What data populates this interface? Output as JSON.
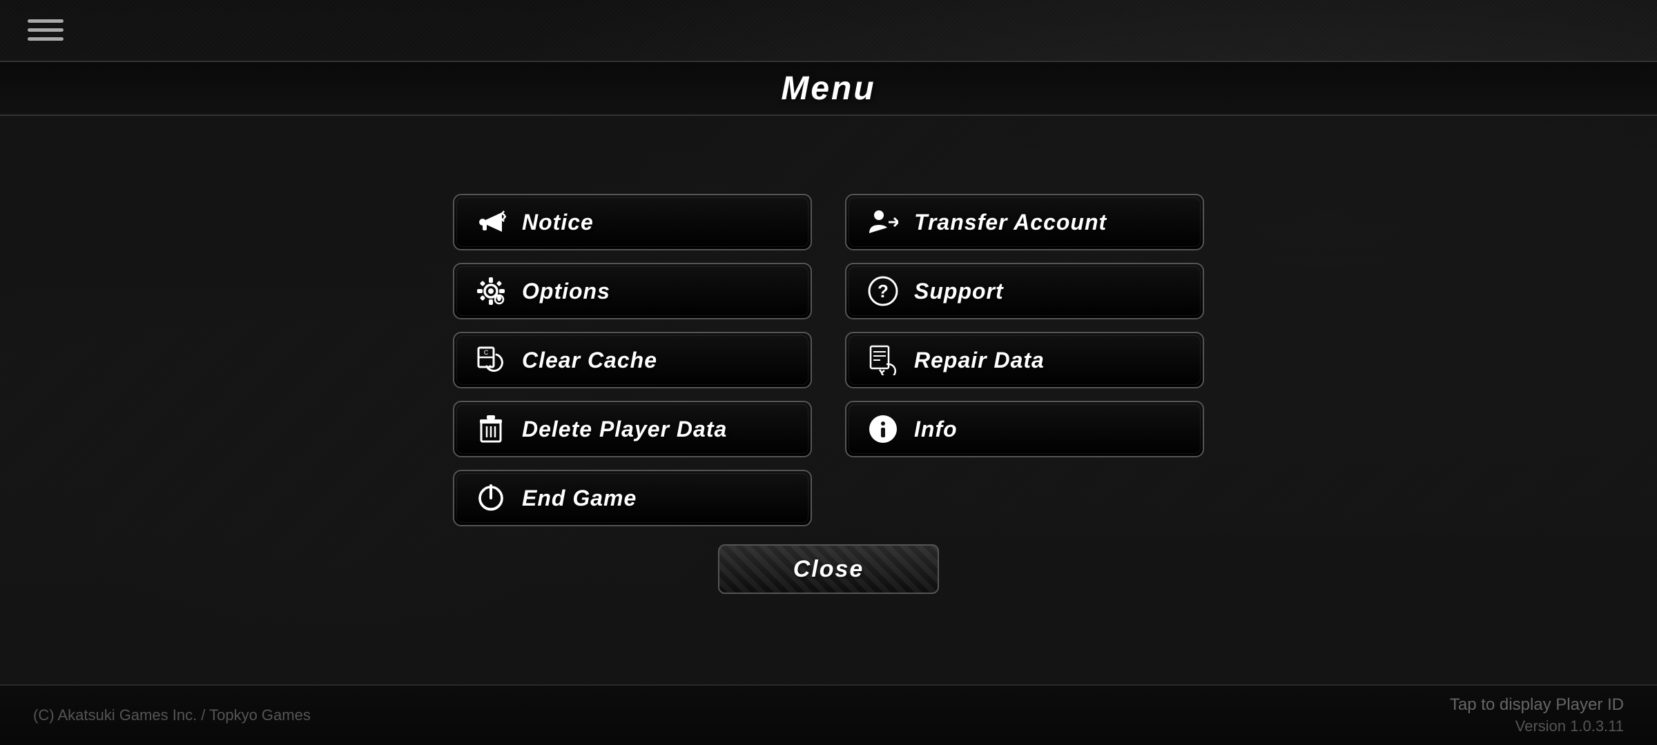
{
  "header": {
    "title": "Menu"
  },
  "hamburger": {
    "label": "hamburger menu"
  },
  "buttons": {
    "notice": {
      "label": "Notice",
      "icon": "notice-icon"
    },
    "transfer_account": {
      "label": "Transfer Account",
      "icon": "transfer-icon"
    },
    "options": {
      "label": "Options",
      "icon": "options-icon"
    },
    "support": {
      "label": "Support",
      "icon": "support-icon"
    },
    "clear_cache": {
      "label": "Clear Cache",
      "icon": "clear-cache-icon"
    },
    "repair_data": {
      "label": "Repair Data",
      "icon": "repair-icon"
    },
    "delete_player_data": {
      "label": "Delete Player Data",
      "icon": "delete-icon"
    },
    "info": {
      "label": "Info",
      "icon": "info-icon"
    },
    "end_game": {
      "label": "End Game",
      "icon": "end-game-icon"
    },
    "close": {
      "label": "Close"
    }
  },
  "footer": {
    "copyright": "(C) Akatsuki Games Inc. / Topkyo Games",
    "player_id_label": "Tap to display Player ID",
    "version": "Version 1.0.3.11"
  }
}
